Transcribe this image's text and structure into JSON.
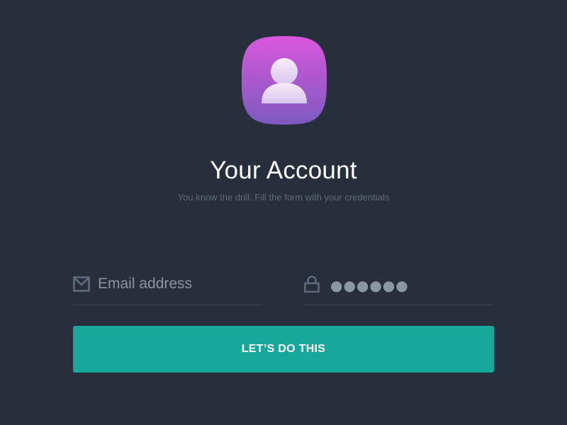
{
  "header": {
    "app_icon": "user-account-icon",
    "title": "Your Account",
    "subtitle": "You know the drill. Fill the form with your credentials"
  },
  "form": {
    "email": {
      "icon": "envelope-icon",
      "placeholder": "Email address",
      "value": ""
    },
    "password": {
      "icon": "lock-icon",
      "value_masked": "●●●●●●"
    },
    "submit_label": "LET’S DO THIS"
  },
  "colors": {
    "background": "#262f3b",
    "accent": "#17a89b",
    "icon_gradient_top": "#d957dd",
    "icon_gradient_bottom": "#7d5ac0",
    "muted_text": "#5f6b7a",
    "input_text": "#8b96a3"
  }
}
